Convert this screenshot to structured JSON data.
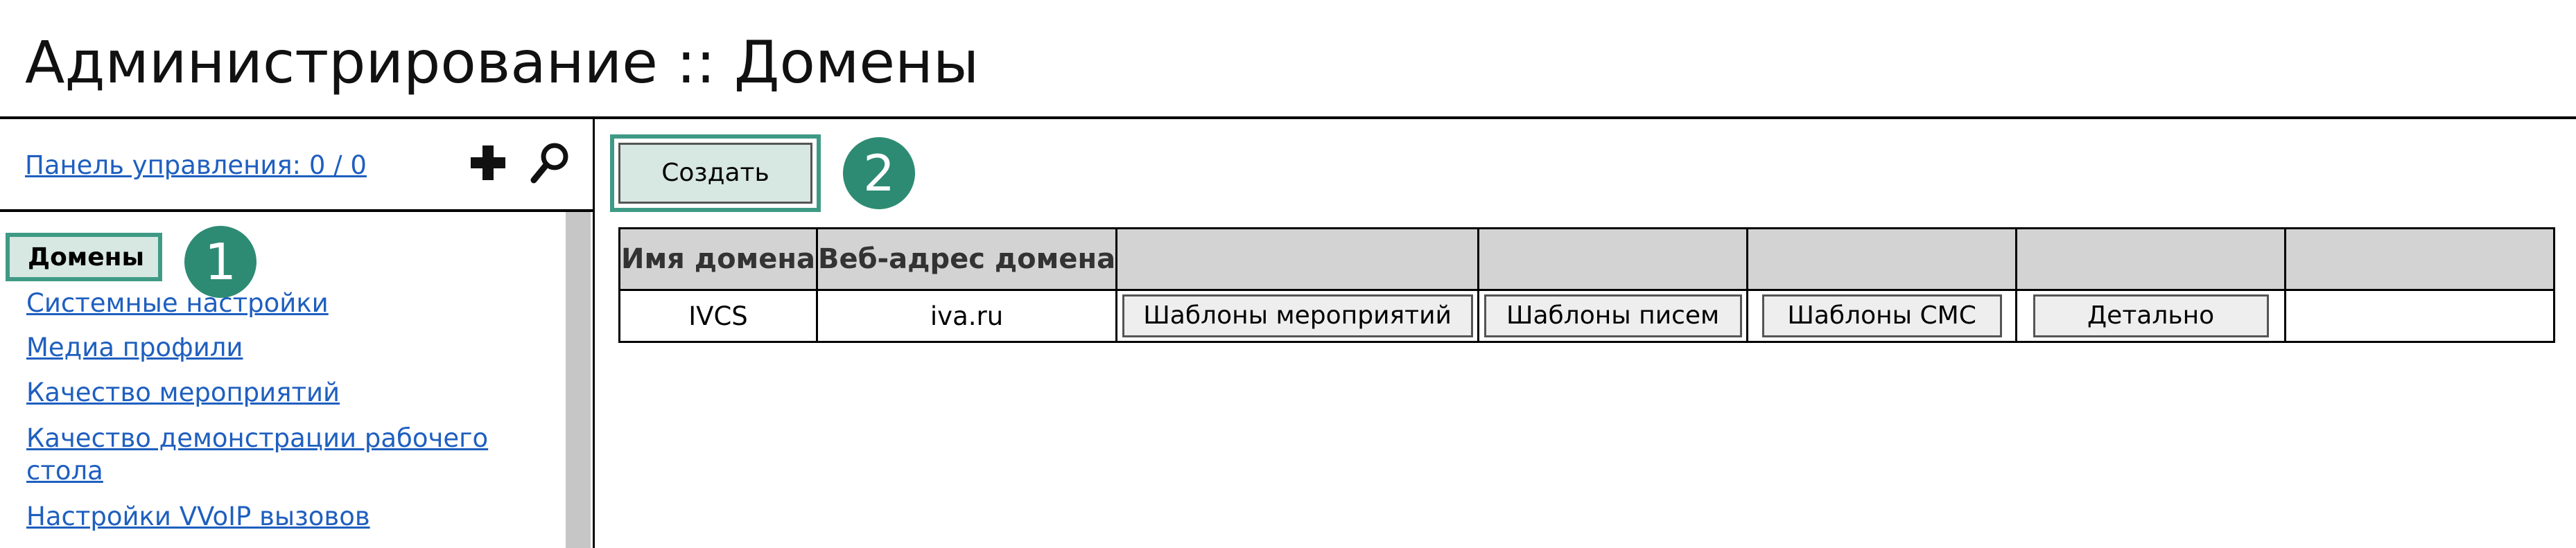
{
  "page": {
    "title": "Администрирование :: Домены"
  },
  "sidebar": {
    "control_panel_link": "Панель управления: 0 / 0",
    "add_icon": "plus-icon",
    "search_icon": "search-icon",
    "active_item": "Домены",
    "items": [
      "Системные настройки",
      "Медиа профили",
      "Качество мероприятий",
      "Качество демонстрации рабочего",
      "стола",
      "Настройки VVoIP вызовов"
    ]
  },
  "annotations": {
    "badge_1": "1",
    "badge_2": "2"
  },
  "toolbar": {
    "create_label": "Создать"
  },
  "table": {
    "headers": [
      "Имя домена",
      "Веб-адрес домена",
      "",
      "",
      "",
      "",
      ""
    ],
    "rows": [
      {
        "name": "IVCS",
        "url": "iva.ru",
        "event_templates": "Шаблоны мероприятий",
        "email_templates": "Шаблоны писем",
        "sms_templates": "Шаблоны СМС",
        "details": "Детально"
      }
    ]
  },
  "colors": {
    "accent": "#3f9a85",
    "badge": "#2e8b73",
    "link": "#1f5fbf",
    "header_bg": "#d3d3d3",
    "highlight_bg": "#d7e7e1"
  }
}
